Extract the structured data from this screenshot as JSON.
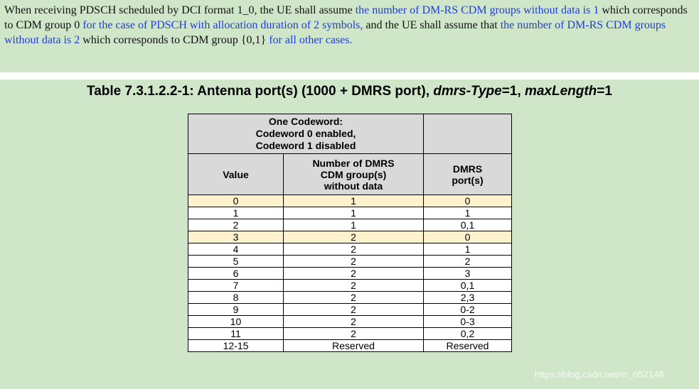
{
  "paragraph": {
    "t1": "When receiving PDSCH scheduled by DCI format 1_0, the UE shall assume ",
    "h1": "the number of DM-RS CDM groups without data is 1",
    "t2": " which corresponds to CDM group 0 ",
    "h2": "for the case of PDSCH with allocation duration of 2 symbols,",
    "t3": " and the UE shall assume that ",
    "h3": "the number of DM-RS CDM groups without data is 2",
    "t4": " which corresponds to CDM group {0,1} ",
    "h4": "for all other cases."
  },
  "caption": {
    "prefix": "Table 7.3.1.2.2-1: Antenna port(s) (1000 + DMRS port), ",
    "dmrs_type_label": "dmrs-Type",
    "dmrs_type_value": "=1, ",
    "max_length_label": "maxLength",
    "max_length_value": "=1"
  },
  "table": {
    "codeword_header": [
      "One Codeword:",
      "Codeword 0 enabled,",
      "Codeword 1 disabled"
    ],
    "col_value": "Value",
    "col_cdm": [
      "Number of DMRS",
      "CDM group(s)",
      "without data"
    ],
    "col_ports": [
      "DMRS",
      "port(s)"
    ],
    "rows": [
      [
        "0",
        "1",
        "0"
      ],
      [
        "1",
        "1",
        "1"
      ],
      [
        "2",
        "1",
        "0,1"
      ],
      [
        "3",
        "2",
        "0"
      ],
      [
        "4",
        "2",
        "1"
      ],
      [
        "5",
        "2",
        "2"
      ],
      [
        "6",
        "2",
        "3"
      ],
      [
        "7",
        "2",
        "0,1"
      ],
      [
        "8",
        "2",
        "2,3"
      ],
      [
        "9",
        "2",
        "0-2"
      ],
      [
        "10",
        "2",
        "0-3"
      ],
      [
        "11",
        "2",
        "0,2"
      ],
      [
        "12-15",
        "Reserved",
        "Reserved"
      ]
    ],
    "highlighted_rows": [
      0,
      3
    ],
    "highlight_color": "#fff2cc"
  },
  "watermark": "https://blog.csdn.net/m_052148",
  "colors": {
    "background": "#cfe6c8",
    "link_text": "#1f3fd6",
    "header_fill": "#d9d9d9"
  }
}
